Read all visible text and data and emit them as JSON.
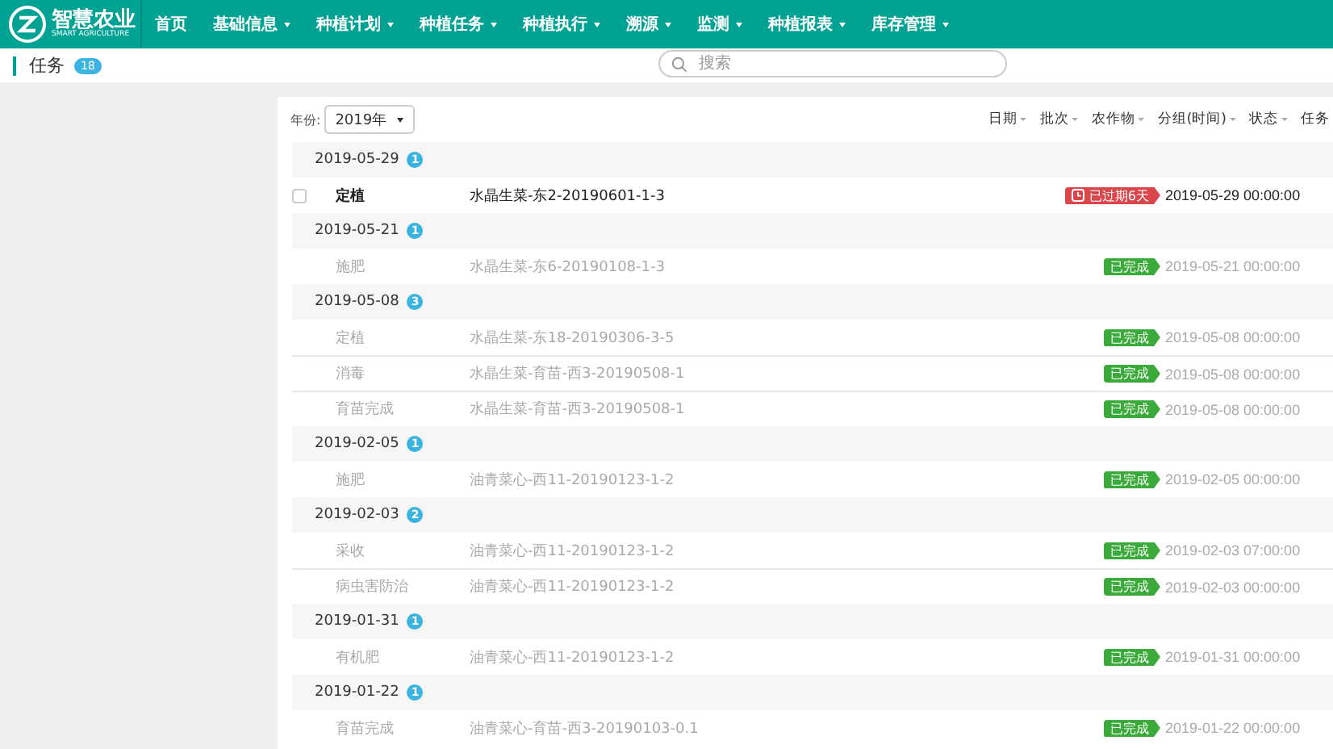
{
  "logo": {
    "name": "智慧农业",
    "subtitle": "SMART AGRICULTURE"
  },
  "nav": [
    {
      "label": "首页",
      "dropdown": false
    },
    {
      "label": "基础信息",
      "dropdown": true
    },
    {
      "label": "种植计划",
      "dropdown": true
    },
    {
      "label": "种植任务",
      "dropdown": true
    },
    {
      "label": "种植执行",
      "dropdown": true
    },
    {
      "label": "溯源",
      "dropdown": true
    },
    {
      "label": "监测",
      "dropdown": true
    },
    {
      "label": "种植报表",
      "dropdown": true
    },
    {
      "label": "库存管理",
      "dropdown": true
    }
  ],
  "page": {
    "title": "任务",
    "count": "18"
  },
  "search": {
    "placeholder": "搜索"
  },
  "year": {
    "label": "年份:",
    "value": "2019年"
  },
  "filters": [
    "日期",
    "批次",
    "农作物",
    "分组(时间)",
    "状态",
    "任务"
  ],
  "groups": [
    {
      "date": "2019-05-29",
      "count": "1",
      "tasks": [
        {
          "name": "定植",
          "batch": "水晶生菜-东2-20190601-1-3",
          "kind": "overdue",
          "badge": "已过期6天",
          "time": "2019-05-29 00:00:00",
          "checked": false
        }
      ]
    },
    {
      "date": "2019-05-21",
      "count": "1",
      "tasks": [
        {
          "name": "施肥",
          "batch": "水晶生菜-东6-20190108-1-3",
          "kind": "done",
          "badge": "已完成",
          "time": "2019-05-21 00:00:00"
        }
      ]
    },
    {
      "date": "2019-05-08",
      "count": "3",
      "tasks": [
        {
          "name": "定植",
          "batch": "水晶生菜-东18-20190306-3-5",
          "kind": "done",
          "badge": "已完成",
          "time": "2019-05-08 00:00:00"
        },
        {
          "name": "消毒",
          "batch": "水晶生菜-育苗-西3-20190508-1",
          "kind": "done",
          "badge": "已完成",
          "time": "2019-05-08 00:00:00"
        },
        {
          "name": "育苗完成",
          "batch": "水晶生菜-育苗-西3-20190508-1",
          "kind": "done",
          "badge": "已完成",
          "time": "2019-05-08 00:00:00"
        }
      ]
    },
    {
      "date": "2019-02-05",
      "count": "1",
      "tasks": [
        {
          "name": "施肥",
          "batch": "油青菜心-西11-20190123-1-2",
          "kind": "done",
          "badge": "已完成",
          "time": "2019-02-05 00:00:00"
        }
      ]
    },
    {
      "date": "2019-02-03",
      "count": "2",
      "tasks": [
        {
          "name": "采收",
          "batch": "油青菜心-西11-20190123-1-2",
          "kind": "done",
          "badge": "已完成",
          "time": "2019-02-03 07:00:00"
        },
        {
          "name": "病虫害防治",
          "batch": "油青菜心-西11-20190123-1-2",
          "kind": "done",
          "badge": "已完成",
          "time": "2019-02-03 00:00:00"
        }
      ]
    },
    {
      "date": "2019-01-31",
      "count": "1",
      "tasks": [
        {
          "name": "有机肥",
          "batch": "油青菜心-西11-20190123-1-2",
          "kind": "done",
          "badge": "已完成",
          "time": "2019-01-31 00:00:00"
        }
      ]
    },
    {
      "date": "2019-01-22",
      "count": "1",
      "tasks": [
        {
          "name": "育苗完成",
          "batch": "油青菜心-育苗-西3-20190103-0.1",
          "kind": "done",
          "badge": "已完成",
          "time": "2019-01-22 00:00:00"
        }
      ]
    }
  ]
}
